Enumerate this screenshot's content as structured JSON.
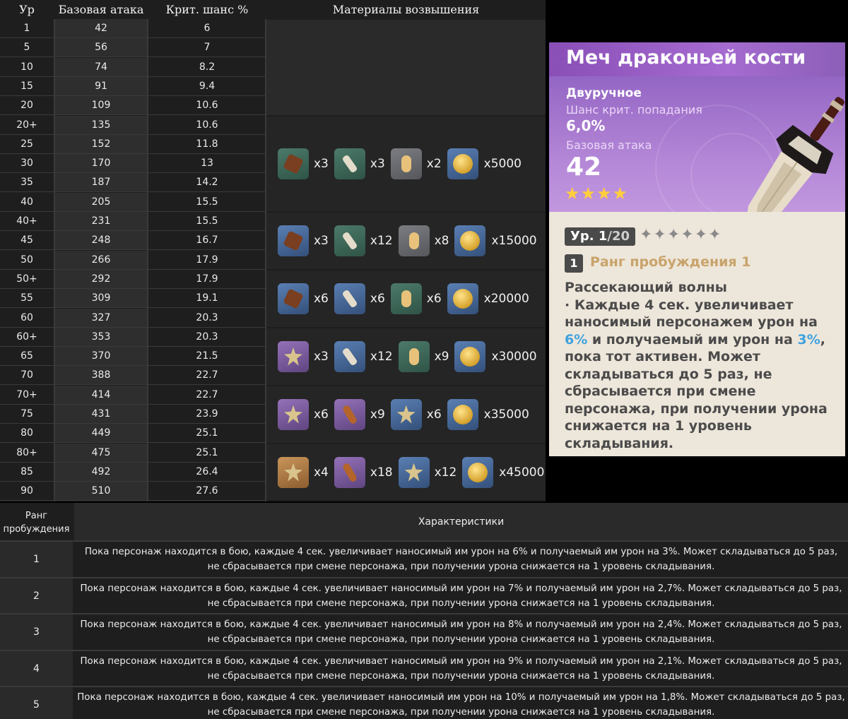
{
  "stats_table": {
    "headers": {
      "level": "Ур",
      "atk": "Базовая атака",
      "crit": "Крит. шанс %",
      "materials": "Материалы возвышения"
    },
    "rows": [
      {
        "lv": "1",
        "atk": "42",
        "crit": "6"
      },
      {
        "lv": "5",
        "atk": "56",
        "crit": "7"
      },
      {
        "lv": "10",
        "atk": "74",
        "crit": "8.2"
      },
      {
        "lv": "15",
        "atk": "91",
        "crit": "9.4"
      },
      {
        "lv": "20",
        "atk": "109",
        "crit": "10.6"
      },
      {
        "lv": "20+",
        "atk": "135",
        "crit": "10.6"
      },
      {
        "lv": "25",
        "atk": "152",
        "crit": "11.8"
      },
      {
        "lv": "30",
        "atk": "170",
        "crit": "13"
      },
      {
        "lv": "35",
        "atk": "187",
        "crit": "14.2"
      },
      {
        "lv": "40",
        "atk": "205",
        "crit": "15.5"
      },
      {
        "lv": "40+",
        "atk": "231",
        "crit": "15.5"
      },
      {
        "lv": "45",
        "atk": "248",
        "crit": "16.7"
      },
      {
        "lv": "50",
        "atk": "266",
        "crit": "17.9"
      },
      {
        "lv": "50+",
        "atk": "292",
        "crit": "17.9"
      },
      {
        "lv": "55",
        "atk": "309",
        "crit": "19.1"
      },
      {
        "lv": "60",
        "atk": "327",
        "crit": "20.3"
      },
      {
        "lv": "60+",
        "atk": "353",
        "crit": "20.3"
      },
      {
        "lv": "65",
        "atk": "370",
        "crit": "21.5"
      },
      {
        "lv": "70",
        "atk": "388",
        "crit": "22.7"
      },
      {
        "lv": "70+",
        "atk": "414",
        "crit": "22.7"
      },
      {
        "lv": "75",
        "atk": "431",
        "crit": "23.9"
      },
      {
        "lv": "80",
        "atk": "449",
        "crit": "25.1"
      },
      {
        "lv": "80+",
        "atk": "475",
        "crit": "25.1"
      },
      {
        "lv": "85",
        "atk": "492",
        "crit": "26.4"
      },
      {
        "lv": "90",
        "atk": "510",
        "crit": "27.6"
      }
    ],
    "material_groups": [
      {
        "items": [
          {
            "icon": "brown-relic-icon",
            "rarity": "green",
            "glyph": "brown",
            "qty": "x3"
          },
          {
            "icon": "bone-icon",
            "rarity": "green",
            "glyph": "bone",
            "qty": "x3"
          },
          {
            "icon": "bottle-icon",
            "rarity": "grey",
            "glyph": "bottle",
            "qty": "x2"
          },
          {
            "icon": "mora-coin-icon",
            "rarity": "blue",
            "glyph": "coin",
            "qty": "x5000"
          }
        ]
      },
      {
        "items": [
          {
            "icon": "brown-relic-icon",
            "rarity": "blue",
            "glyph": "brown",
            "qty": "x3"
          },
          {
            "icon": "bone-icon",
            "rarity": "green",
            "glyph": "bone",
            "qty": "x12"
          },
          {
            "icon": "bottle-icon",
            "rarity": "grey",
            "glyph": "bottle",
            "qty": "x8"
          },
          {
            "icon": "mora-coin-icon",
            "rarity": "blue",
            "glyph": "coin",
            "qty": "x15000"
          }
        ]
      },
      {
        "items": [
          {
            "icon": "brown-relic-icon",
            "rarity": "blue",
            "glyph": "brown",
            "qty": "x6"
          },
          {
            "icon": "bone-club-icon",
            "rarity": "blue",
            "glyph": "bone",
            "qty": "x6"
          },
          {
            "icon": "bottle-icon",
            "rarity": "green",
            "glyph": "bottle",
            "qty": "x6"
          },
          {
            "icon": "mora-coin-icon",
            "rarity": "blue",
            "glyph": "coin",
            "qty": "x20000"
          }
        ]
      },
      {
        "items": [
          {
            "icon": "star-relic-icon",
            "rarity": "purple",
            "glyph": "star",
            "qty": "x3"
          },
          {
            "icon": "bone-club-icon",
            "rarity": "blue",
            "glyph": "bone",
            "qty": "x12"
          },
          {
            "icon": "bottle-icon",
            "rarity": "green",
            "glyph": "bottle",
            "qty": "x9"
          },
          {
            "icon": "mora-coin-icon",
            "rarity": "blue",
            "glyph": "coin",
            "qty": "x30000"
          }
        ]
      },
      {
        "items": [
          {
            "icon": "star-relic-icon",
            "rarity": "purple",
            "glyph": "star",
            "qty": "x6"
          },
          {
            "icon": "club-icon",
            "rarity": "purple",
            "glyph": "club",
            "qty": "x9"
          },
          {
            "icon": "vase-icon",
            "rarity": "blue",
            "glyph": "star",
            "qty": "x6"
          },
          {
            "icon": "mora-coin-icon",
            "rarity": "blue",
            "glyph": "coin",
            "qty": "x35000"
          }
        ]
      },
      {
        "items": [
          {
            "icon": "star-relic-icon",
            "rarity": "gold",
            "glyph": "star",
            "qty": "x4"
          },
          {
            "icon": "club-icon",
            "rarity": "purple",
            "glyph": "club",
            "qty": "x18"
          },
          {
            "icon": "vase-icon",
            "rarity": "blue",
            "glyph": "star",
            "qty": "x12"
          },
          {
            "icon": "mora-coin-icon",
            "rarity": "blue",
            "glyph": "coin",
            "qty": "x45000"
          }
        ]
      }
    ]
  },
  "weapon_card": {
    "title": "Меч драконьей кости",
    "type": "Двуручное",
    "crit_label": "Шанс крит. попадания",
    "crit_value": "6,0%",
    "atk_label": "Базовая атака",
    "atk_value": "42",
    "rarity_stars": "★★★★",
    "level_prefix": "Ур. ",
    "level_current": "1",
    "level_max": "/20",
    "ascension_stars": "✦✦✦✦✦✦",
    "refinement_number": "1",
    "refinement_label": "Ранг пробуждения 1",
    "passive_name": "Рассекающий волны",
    "passive_part1": "· Каждые 4 сек. увеличивает наносимый персонажем урон на ",
    "passive_hl1": "6%",
    "passive_part2": " и получаемый им урон на ",
    "passive_hl2": "3%",
    "passive_part3": ", пока тот активен. Может складываться до 5 раз, не сбрасывается при смене персонажа, при получении урона снижается на 1 уровень складывания.",
    "highlight_color": "#3fa2e0"
  },
  "refinement_table": {
    "header_rank": "Ранг пробуждения",
    "header_features": "Характеристики",
    "rows": [
      {
        "rank": "1",
        "line1": "Пока персонаж находится в бою, каждые 4 сек. увеличивает наносимый им урон на 6% и получаемый им урон на 3%. Может складываться до 5 раз,",
        "line2": "не сбрасывается при смене персонажа, при получении урона снижается на 1 уровень складывания."
      },
      {
        "rank": "2",
        "line1": "Пока персонаж находится в бою, каждые 4 сек. увеличивает наносимый им урон на 7% и получаемый им урон на 2,7%. Может складываться до 5 раз,",
        "line2": "не сбрасывается при смене персонажа, при получении урона снижается на 1 уровень складывания."
      },
      {
        "rank": "3",
        "line1": "Пока персонаж находится в бою, каждые 4 сек. увеличивает наносимый им урон на 8% и получаемый им урон на 2,4%. Может складываться до 5 раз,",
        "line2": "не сбрасывается при смене персонажа, при получении урона снижается на 1 уровень складывания."
      },
      {
        "rank": "4",
        "line1": "Пока персонаж находится в бою, каждые 4 сек. увеличивает наносимый им урон на 9% и получаемый им урон на 2,1%. Может складываться до 5 раз,",
        "line2": "не сбрасывается при смене персонажа, при получении урона снижается на 1 уровень складывания."
      },
      {
        "rank": "5",
        "line1": "Пока персонаж находится в бою, каждые 4 сек. увеличивает наносимый им урон на 10% и получаемый им урон на 1,8%. Может складываться до 5 раз,",
        "line2": "не сбрасывается при смене персонажа, при получении урона снижается на 1 уровень складывания."
      }
    ]
  }
}
